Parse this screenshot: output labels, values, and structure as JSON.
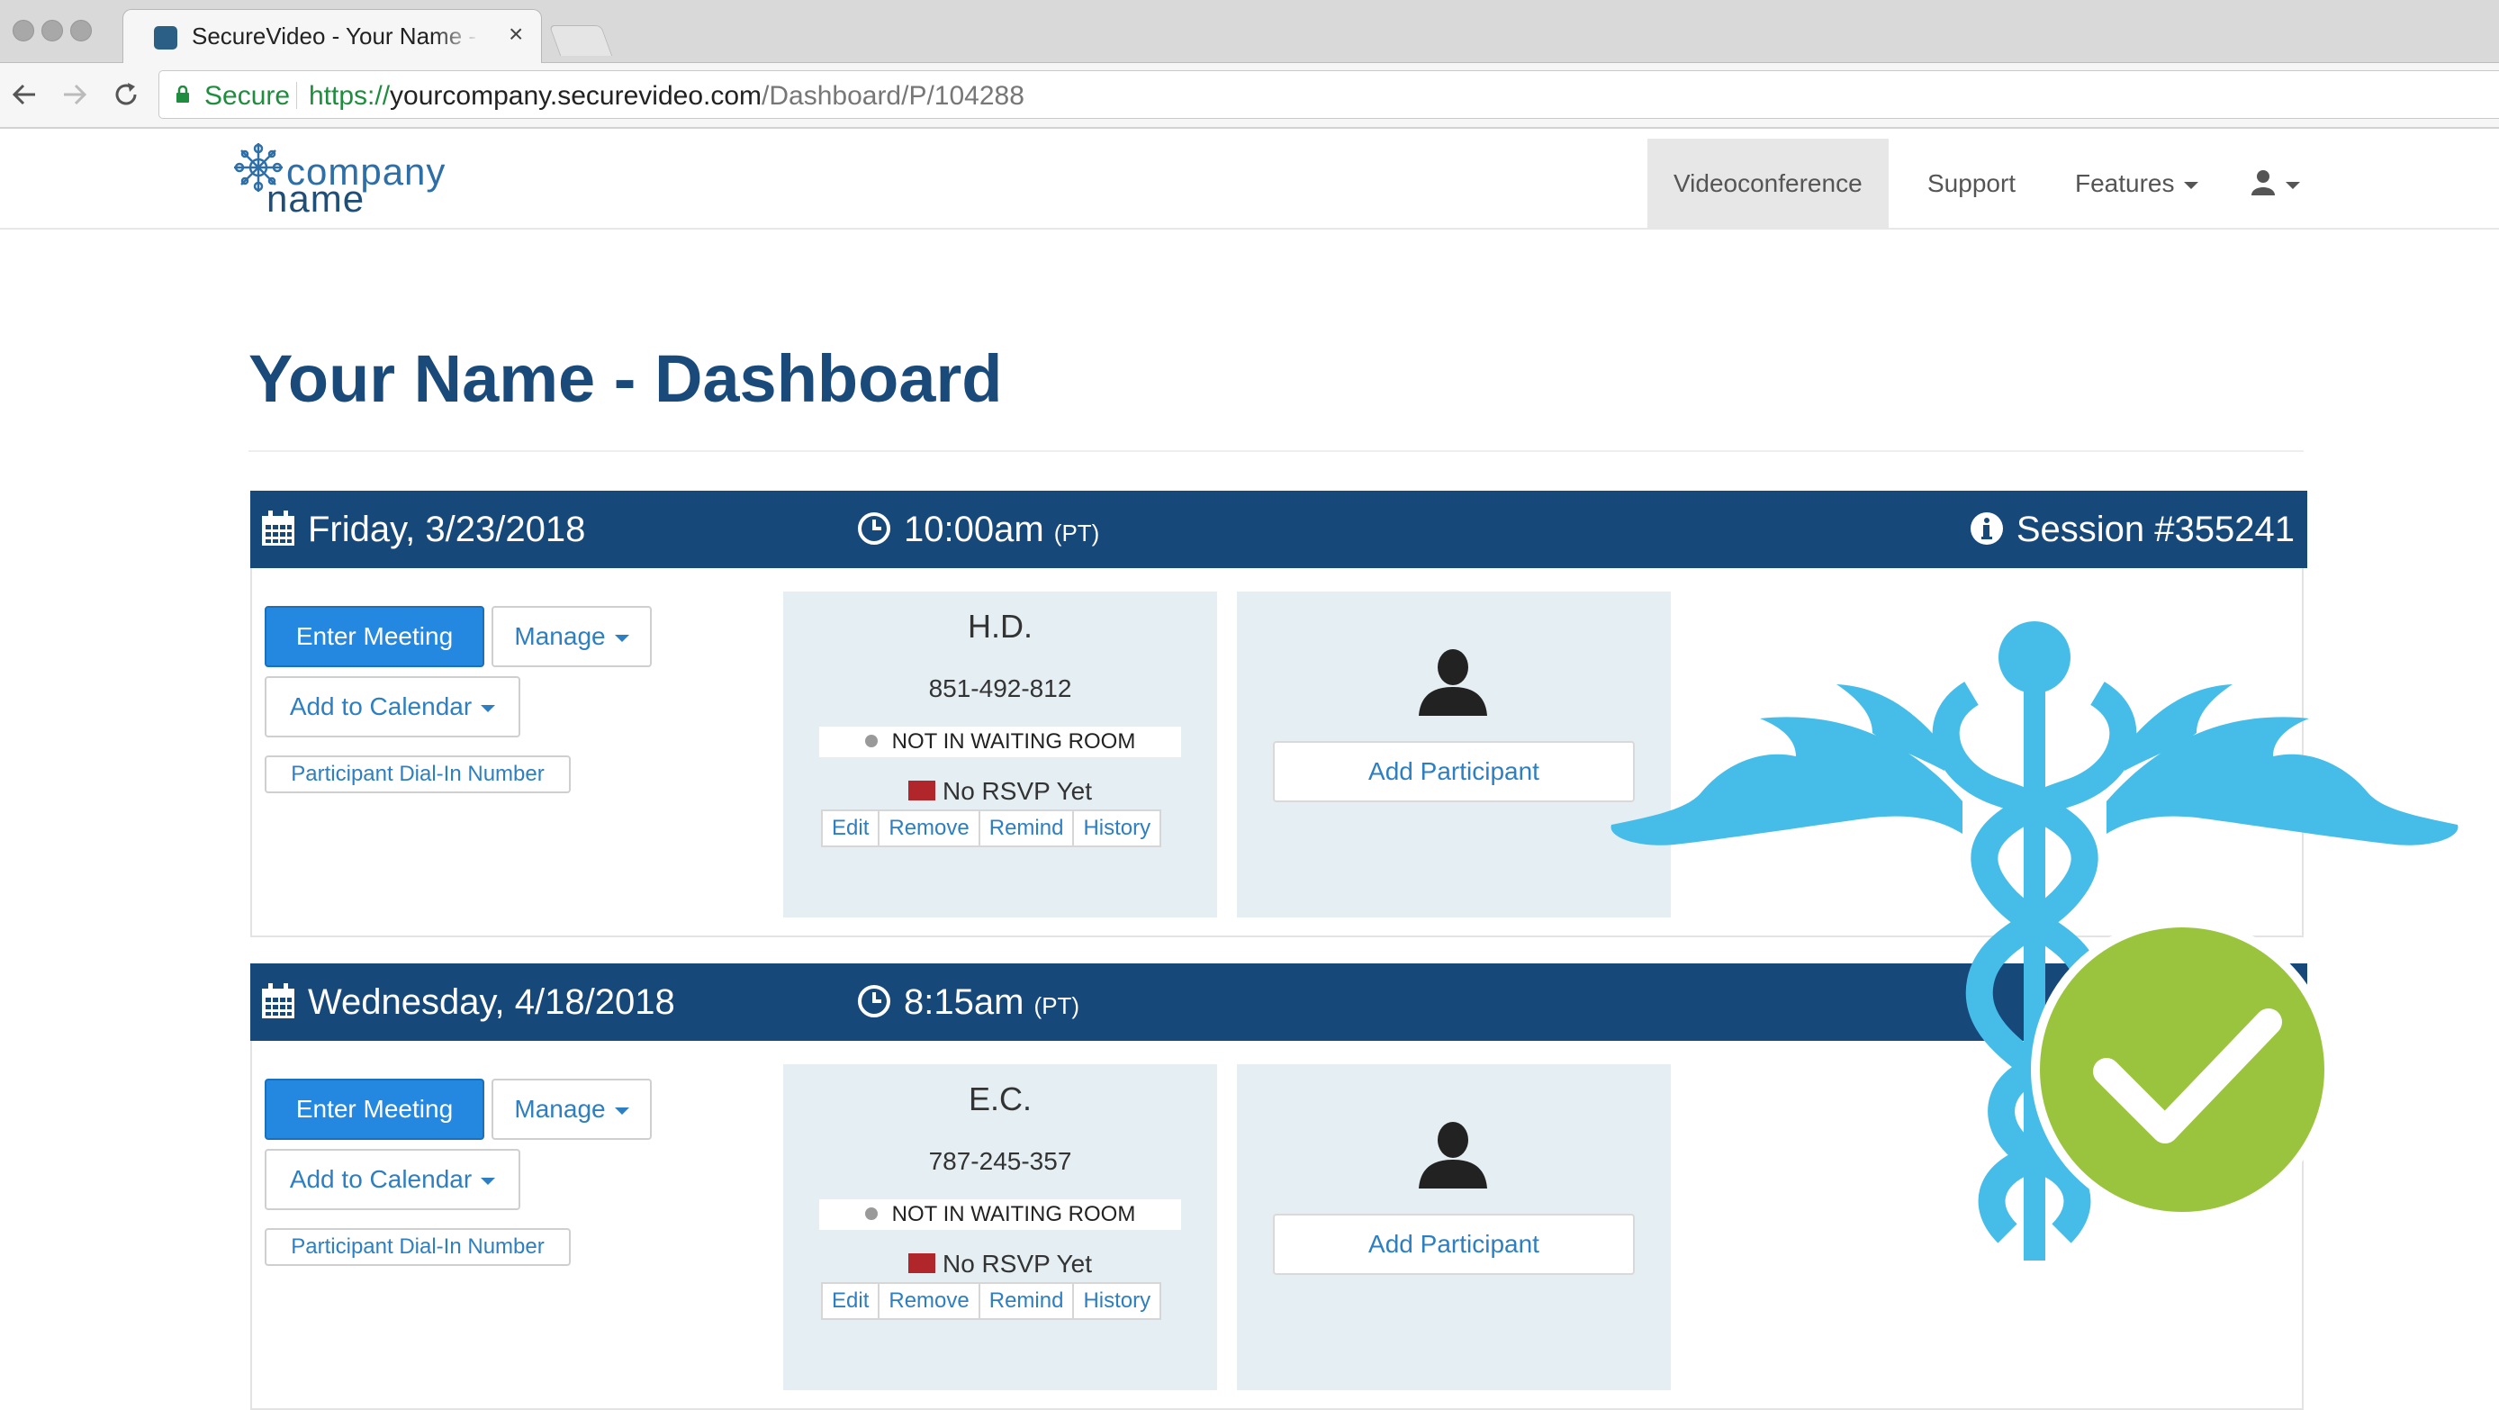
{
  "browser": {
    "tab_title": "SecureVideo - Your Name - Dashboard",
    "tab_close": "×",
    "secure_label": "Secure",
    "url_scheme": "https://",
    "url_host": "yourcompany.securevideo.com",
    "url_path": "/Dashboard/P/104288"
  },
  "logo": {
    "line1": "company",
    "line2": "name"
  },
  "nav": {
    "items": [
      {
        "label": "Videoconference",
        "active": true
      },
      {
        "label": "Support"
      },
      {
        "label": "Features"
      }
    ]
  },
  "page": {
    "title": "Your Name - Dashboard"
  },
  "sessions": [
    {
      "date": "Friday, 3/23/2018",
      "time": "10:00am",
      "tz": "(PT)",
      "session_label": "Session #355241",
      "enter_label": "Enter Meeting",
      "manage_label": "Manage",
      "calendar_label": "Add to Calendar",
      "dialin_label": "Participant Dial-In Number",
      "participant": {
        "name": "H.D.",
        "phone": "851-492-812",
        "status": "NOT IN WAITING ROOM",
        "rsvp": "No RSVP Yet",
        "actions": [
          "Edit",
          "Remove",
          "Remind",
          "History"
        ]
      },
      "add_label": "Add Participant"
    },
    {
      "date": "Wednesday, 4/18/2018",
      "time": "8:15am",
      "tz": "(PT)",
      "enter_label": "Enter Meeting",
      "manage_label": "Manage",
      "calendar_label": "Add to Calendar",
      "dialin_label": "Participant Dial-In Number",
      "participant": {
        "name": "E.C.",
        "phone": "787-245-357",
        "status": "NOT IN WAITING ROOM",
        "rsvp": "No RSVP Yet",
        "actions": [
          "Edit",
          "Remove",
          "Remind",
          "History"
        ]
      },
      "add_label": "Add Participant"
    }
  ],
  "colors": {
    "header_bg": "#17487a",
    "primary_button": "#2488e0",
    "link": "#2d7fc1",
    "caduceus": "#46bde9",
    "check_badge": "#9ac43e"
  },
  "icons": [
    "lock-icon",
    "calendar-icon",
    "clock-icon",
    "info-icon",
    "user-icon",
    "person-icon",
    "envelope-icon",
    "caduceus-icon",
    "checkmark-icon"
  ]
}
